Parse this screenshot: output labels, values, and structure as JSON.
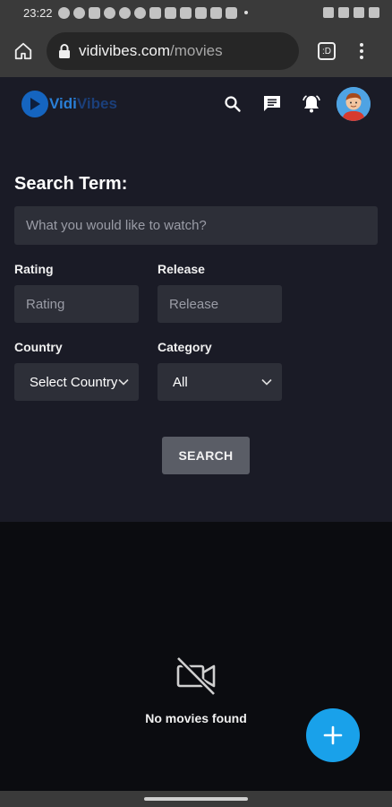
{
  "status_bar": {
    "time": "23:22"
  },
  "browser": {
    "url_host": "vidivibes.com",
    "url_path": "/movies",
    "tabs_count": ":D"
  },
  "app": {
    "logo_text_a": "Vidi",
    "logo_text_b": "Vibes"
  },
  "search_form": {
    "title": "Search Term:",
    "term_placeholder": "What you would like to watch?",
    "rating_label": "Rating",
    "rating_placeholder": "Rating",
    "release_label": "Release",
    "release_placeholder": "Release",
    "country_label": "Country",
    "country_value": "Select Country",
    "category_label": "Category",
    "category_value": "All",
    "search_button": "SEARCH"
  },
  "results": {
    "empty_message": "No movies found"
  },
  "colors": {
    "accent": "#19a1ea",
    "panel": "#1a1b26",
    "background": "#0b0c10"
  }
}
